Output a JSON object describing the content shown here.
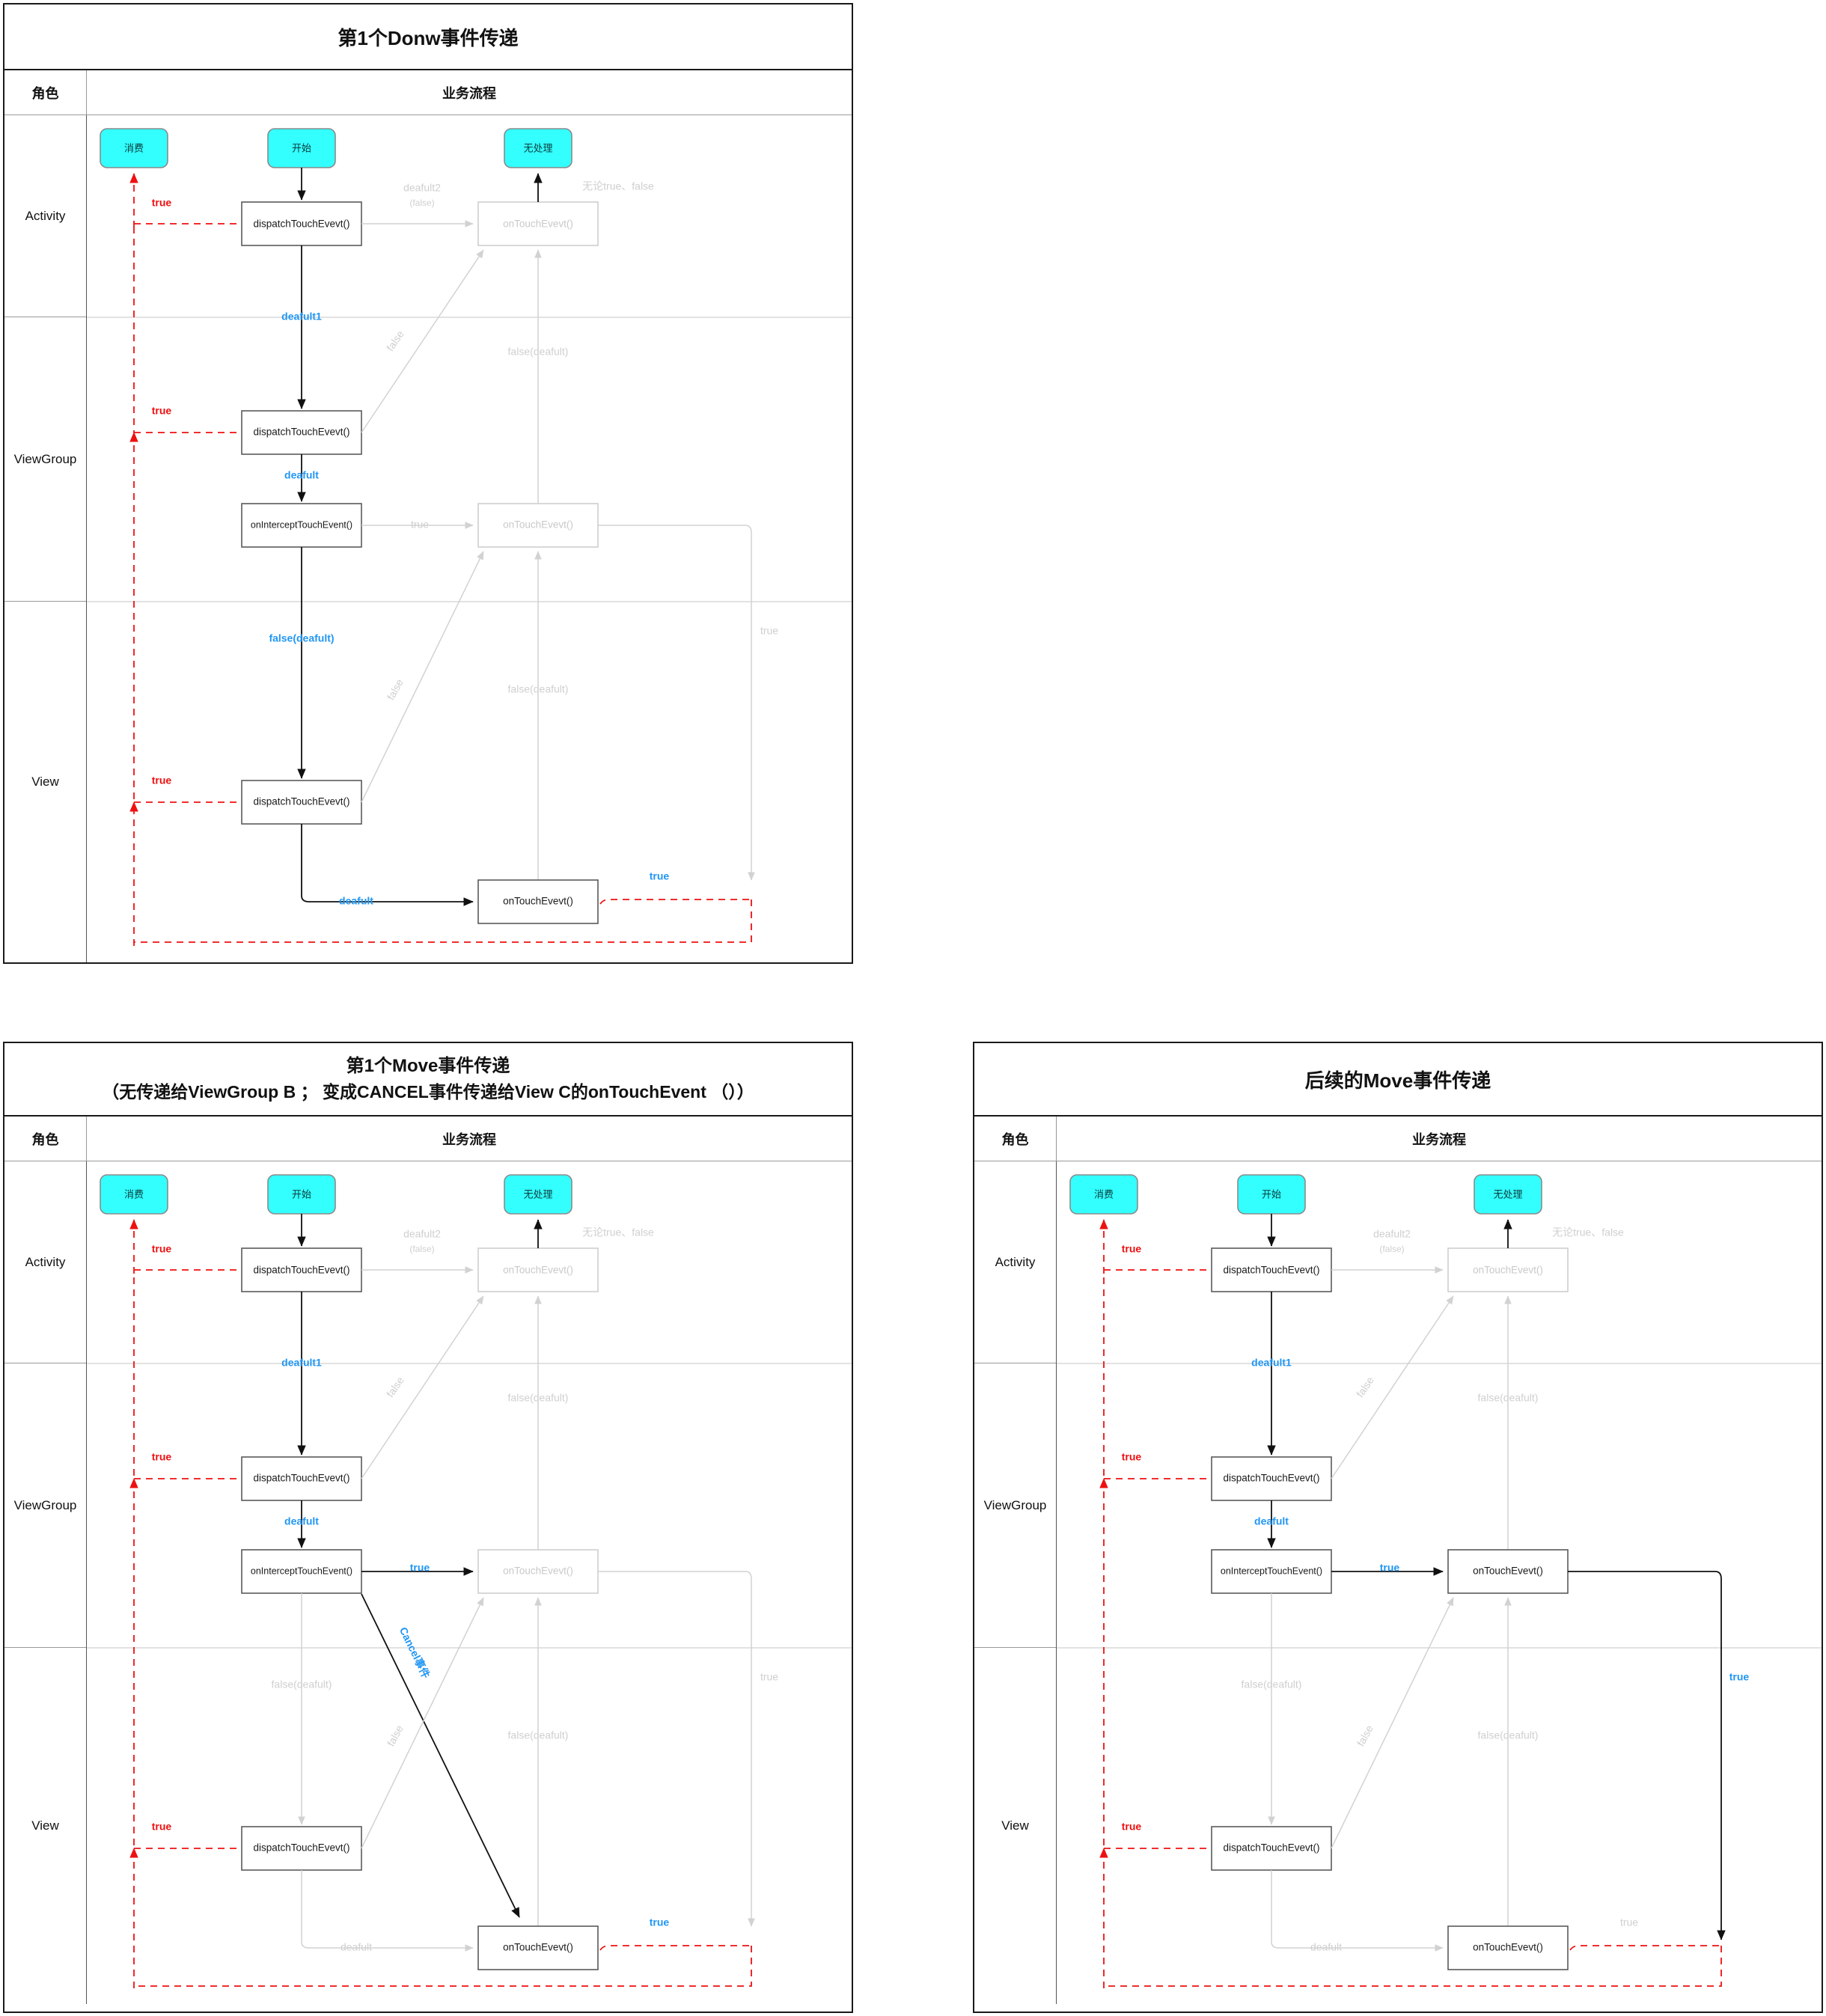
{
  "panels": [
    {
      "id": "down",
      "title": "第1个Donw事件传递",
      "subtitle": "",
      "header": {
        "role": "角色",
        "flow": "业务流程"
      },
      "lanes": [
        "Activity",
        "ViewGroup",
        "View"
      ],
      "terminals": {
        "consume": "消费",
        "start": "开始",
        "nohandle": "无处理"
      },
      "nodes": {
        "activity_dispatch": "dispatchTouchEvevt()",
        "activity_ontouch": "onTouchEvevt()",
        "viewgroup_dispatch": "dispatchTouchEvevt()",
        "viewgroup_intercept": "onInterceptTouchEvent()",
        "viewgroup_ontouch": "onTouchEvevt()",
        "view_dispatch": "dispatchTouchEvevt()",
        "view_ontouch": "onTouchEvevt()"
      },
      "labels": {
        "activity_true": "true",
        "deafult2": "deafult2",
        "deafult2_false": "(false)",
        "regardless": "无论true、false",
        "deafult1": "deafult1",
        "false_diag_vg": "false",
        "false_deafult_act": "false(deafult)",
        "viewgroup_true": "true",
        "deafult": "deafult",
        "intercept_true": "true",
        "false_deafult_view_left": "false(deafult)",
        "false_diag_view": "false",
        "false_deafult_view_right": "false(deafult)",
        "view_true": "true",
        "right_true": "true",
        "view_deafult": "deafult",
        "ontouch_true": "true"
      }
    },
    {
      "id": "move1",
      "title": "第1个Move事件传递",
      "subtitle": "（无传递给ViewGroup B ； 变成CANCEL事件传递给View C的onTouchEvent （））",
      "header": {
        "role": "角色",
        "flow": "业务流程"
      },
      "lanes": [
        "Activity",
        "ViewGroup",
        "View"
      ],
      "terminals": {
        "consume": "消费",
        "start": "开始",
        "nohandle": "无处理"
      },
      "nodes": {
        "activity_dispatch": "dispatchTouchEvevt()",
        "activity_ontouch": "onTouchEvevt()",
        "viewgroup_dispatch": "dispatchTouchEvevt()",
        "viewgroup_intercept": "onInterceptTouchEvent()",
        "viewgroup_ontouch": "onTouchEvevt()",
        "view_dispatch": "dispatchTouchEvevt()",
        "view_ontouch": "onTouchEvevt()"
      },
      "labels": {
        "activity_true": "true",
        "deafult2": "deafult2",
        "deafult2_false": "(false)",
        "regardless": "无论true、false",
        "deafult1": "deafult1",
        "false_diag_vg": "false",
        "false_deafult_act": "false(deafult)",
        "viewgroup_true": "true",
        "deafult": "deafult",
        "intercept_true": "true",
        "cancel_event": "Cancel事件",
        "false_deafult_view_left": "false(deafult)",
        "false_diag_view": "false",
        "false_deafult_view_right": "false(deafult)",
        "view_true": "true",
        "right_true": "true",
        "view_deafult": "deafult",
        "ontouch_true": "true"
      }
    },
    {
      "id": "move2",
      "title": "后续的Move事件传递",
      "subtitle": "",
      "header": {
        "role": "角色",
        "flow": "业务流程"
      },
      "lanes": [
        "Activity",
        "ViewGroup",
        "View"
      ],
      "terminals": {
        "consume": "消费",
        "start": "开始",
        "nohandle": "无处理"
      },
      "nodes": {
        "activity_dispatch": "dispatchTouchEvevt()",
        "activity_ontouch": "onTouchEvevt()",
        "viewgroup_dispatch": "dispatchTouchEvevt()",
        "viewgroup_intercept": "onInterceptTouchEvent()",
        "viewgroup_ontouch": "onTouchEvevt()",
        "view_dispatch": "dispatchTouchEvevt()",
        "view_ontouch": "onTouchEvevt()"
      },
      "labels": {
        "activity_true": "true",
        "deafult2": "deafult2",
        "deafult2_false": "(false)",
        "regardless": "无论true、false",
        "deafult1": "deafult1",
        "false_diag_vg": "false",
        "false_deafult_act": "false(deafult)",
        "viewgroup_true": "true",
        "deafult": "deafult",
        "intercept_true": "true",
        "false_deafult_view_left": "false(deafult)",
        "false_diag_view": "false",
        "false_deafult_view_right": "false(deafult)",
        "view_true": "true",
        "right_true": "true",
        "view_deafult": "deafult",
        "ontouch_true": "true"
      }
    }
  ],
  "colors": {
    "terminal_fill": "#33ffff",
    "blue_label": "#2196f3",
    "red_label": "#ee1111",
    "dim_gray": "#cfcfcf",
    "node_stroke": "#5a5a5a"
  }
}
